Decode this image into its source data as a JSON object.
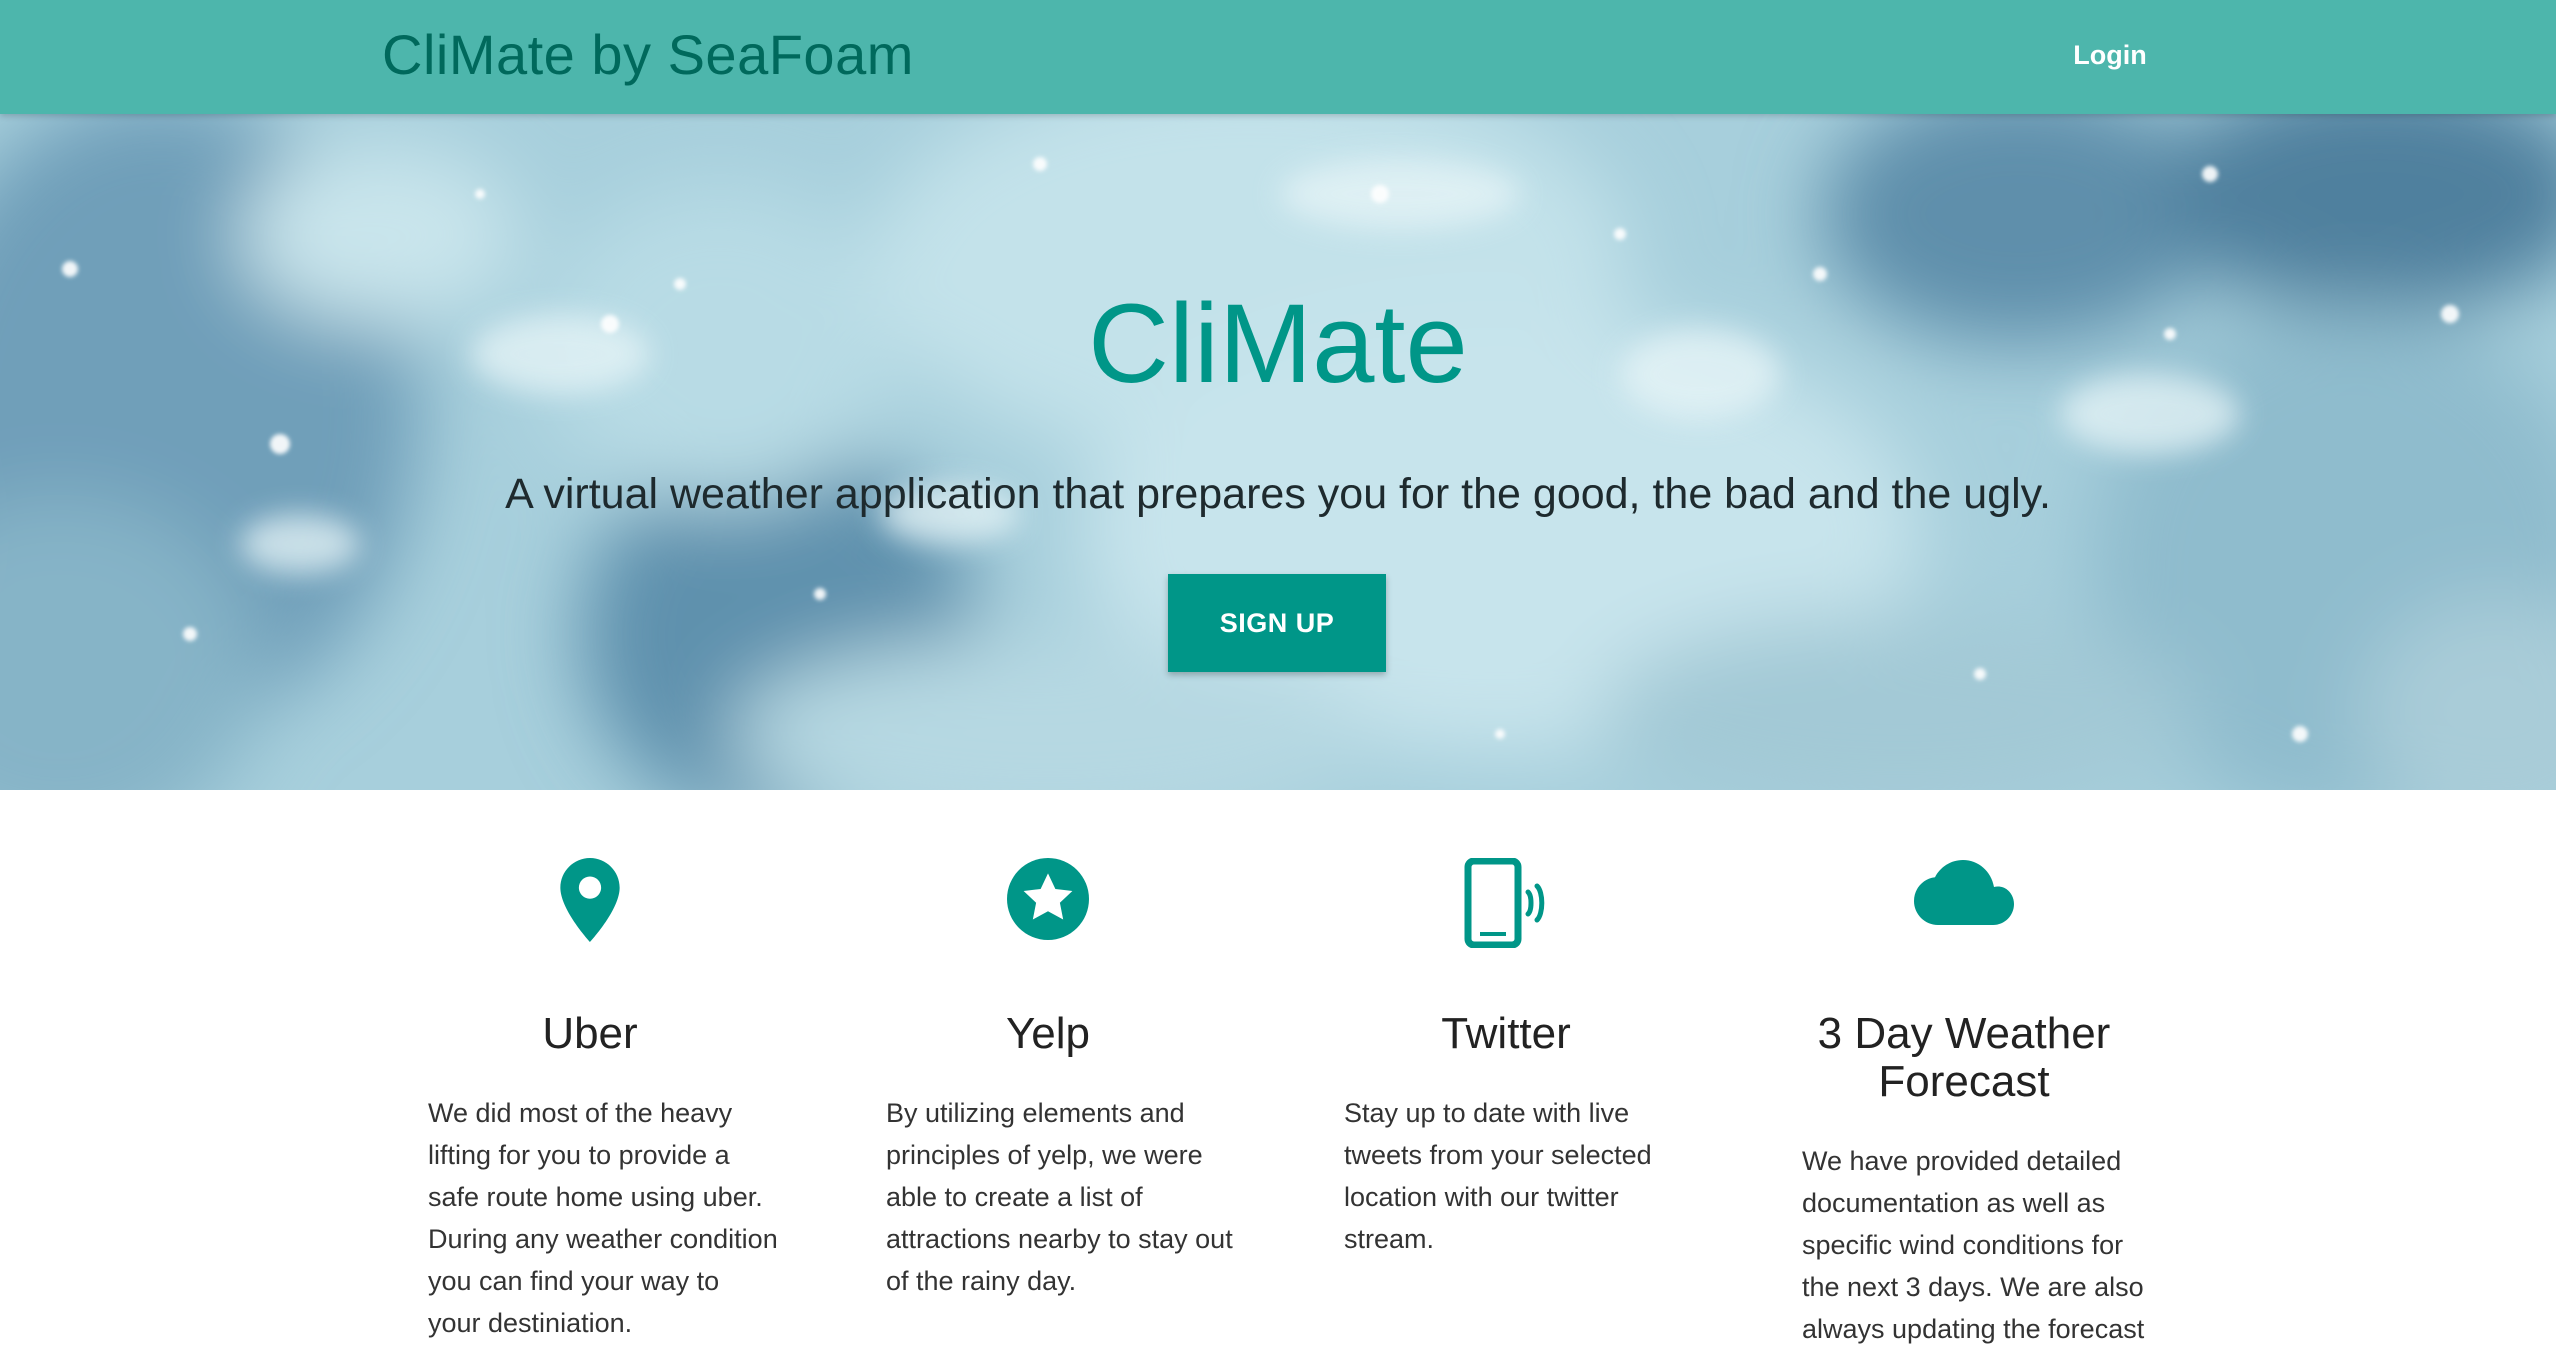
{
  "navbar": {
    "brand": "CliMate by SeaFoam",
    "login_label": "Login"
  },
  "hero": {
    "title": "CliMate",
    "subtitle": "A virtual weather application that prepares you for the good, the bad and the ugly.",
    "signup_label": "SIGN UP"
  },
  "features": [
    {
      "icon": "location-pin-icon",
      "title": "Uber",
      "text": "We did most of the heavy lifting for you to provide a safe route home using uber. During any weather condition you can find your way to your destiniation."
    },
    {
      "icon": "star-icon",
      "title": "Yelp",
      "text": "By utilizing elements and principles of yelp, we were able to create a list of attractions nearby to stay out of the rainy day."
    },
    {
      "icon": "phone-vibrate-icon",
      "title": "Twitter",
      "text": "Stay up to date with live tweets from your selected location with our twitter stream."
    },
    {
      "icon": "cloud-icon",
      "title": "3 Day Weather Forecast",
      "text": "We have provided detailed documentation as well as specific wind conditions for the next 3 days. We are also always updating the forecast"
    }
  ],
  "colors": {
    "navbar": "#4db6ac",
    "brand": "#00695c",
    "accent": "#009688"
  }
}
